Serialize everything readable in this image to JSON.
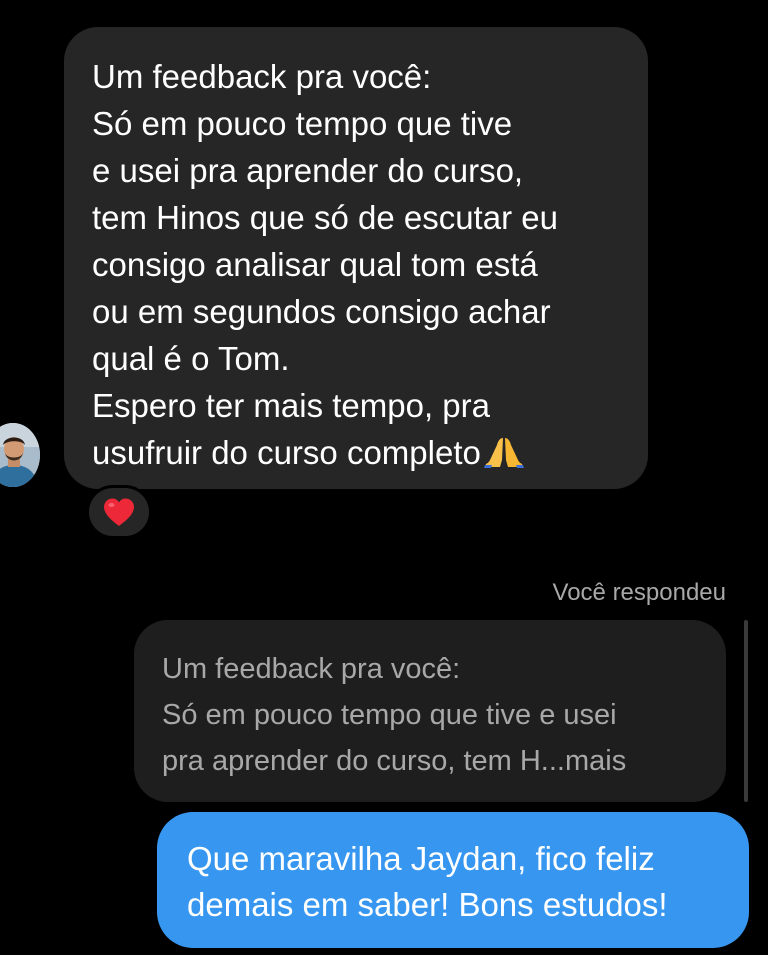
{
  "incoming_message": {
    "lines": [
      "Um feedback pra você:",
      "Só em pouco tempo que tive",
      "e usei pra aprender do curso,",
      "tem Hinos que só de escutar eu",
      "consigo analisar qual tom está",
      "ou em segundos consigo achar",
      "qual é o Tom.",
      "Espero ter mais tempo, pra",
      "usufruir do curso completo"
    ],
    "trailing_emoji": "folded-hands-emoji",
    "reaction": "red-heart-emoji"
  },
  "reply_section": {
    "label": "Você respondeu",
    "quoted_lines": [
      "Um feedback pra você:",
      "Só em pouco tempo que tive e usei",
      "pra aprender do curso, tem H...mais"
    ]
  },
  "outgoing_message": {
    "lines": [
      "Que maravilha Jaydan, fico feliz",
      "demais em saber! Bons estudos!"
    ]
  },
  "colors": {
    "background": "#000000",
    "incoming_bubble": "#262626",
    "quoted_bubble": "#1e1e1e",
    "outgoing_bubble": "#3797f0",
    "muted_text": "#a8a8a8",
    "heart": "#ed2939"
  }
}
